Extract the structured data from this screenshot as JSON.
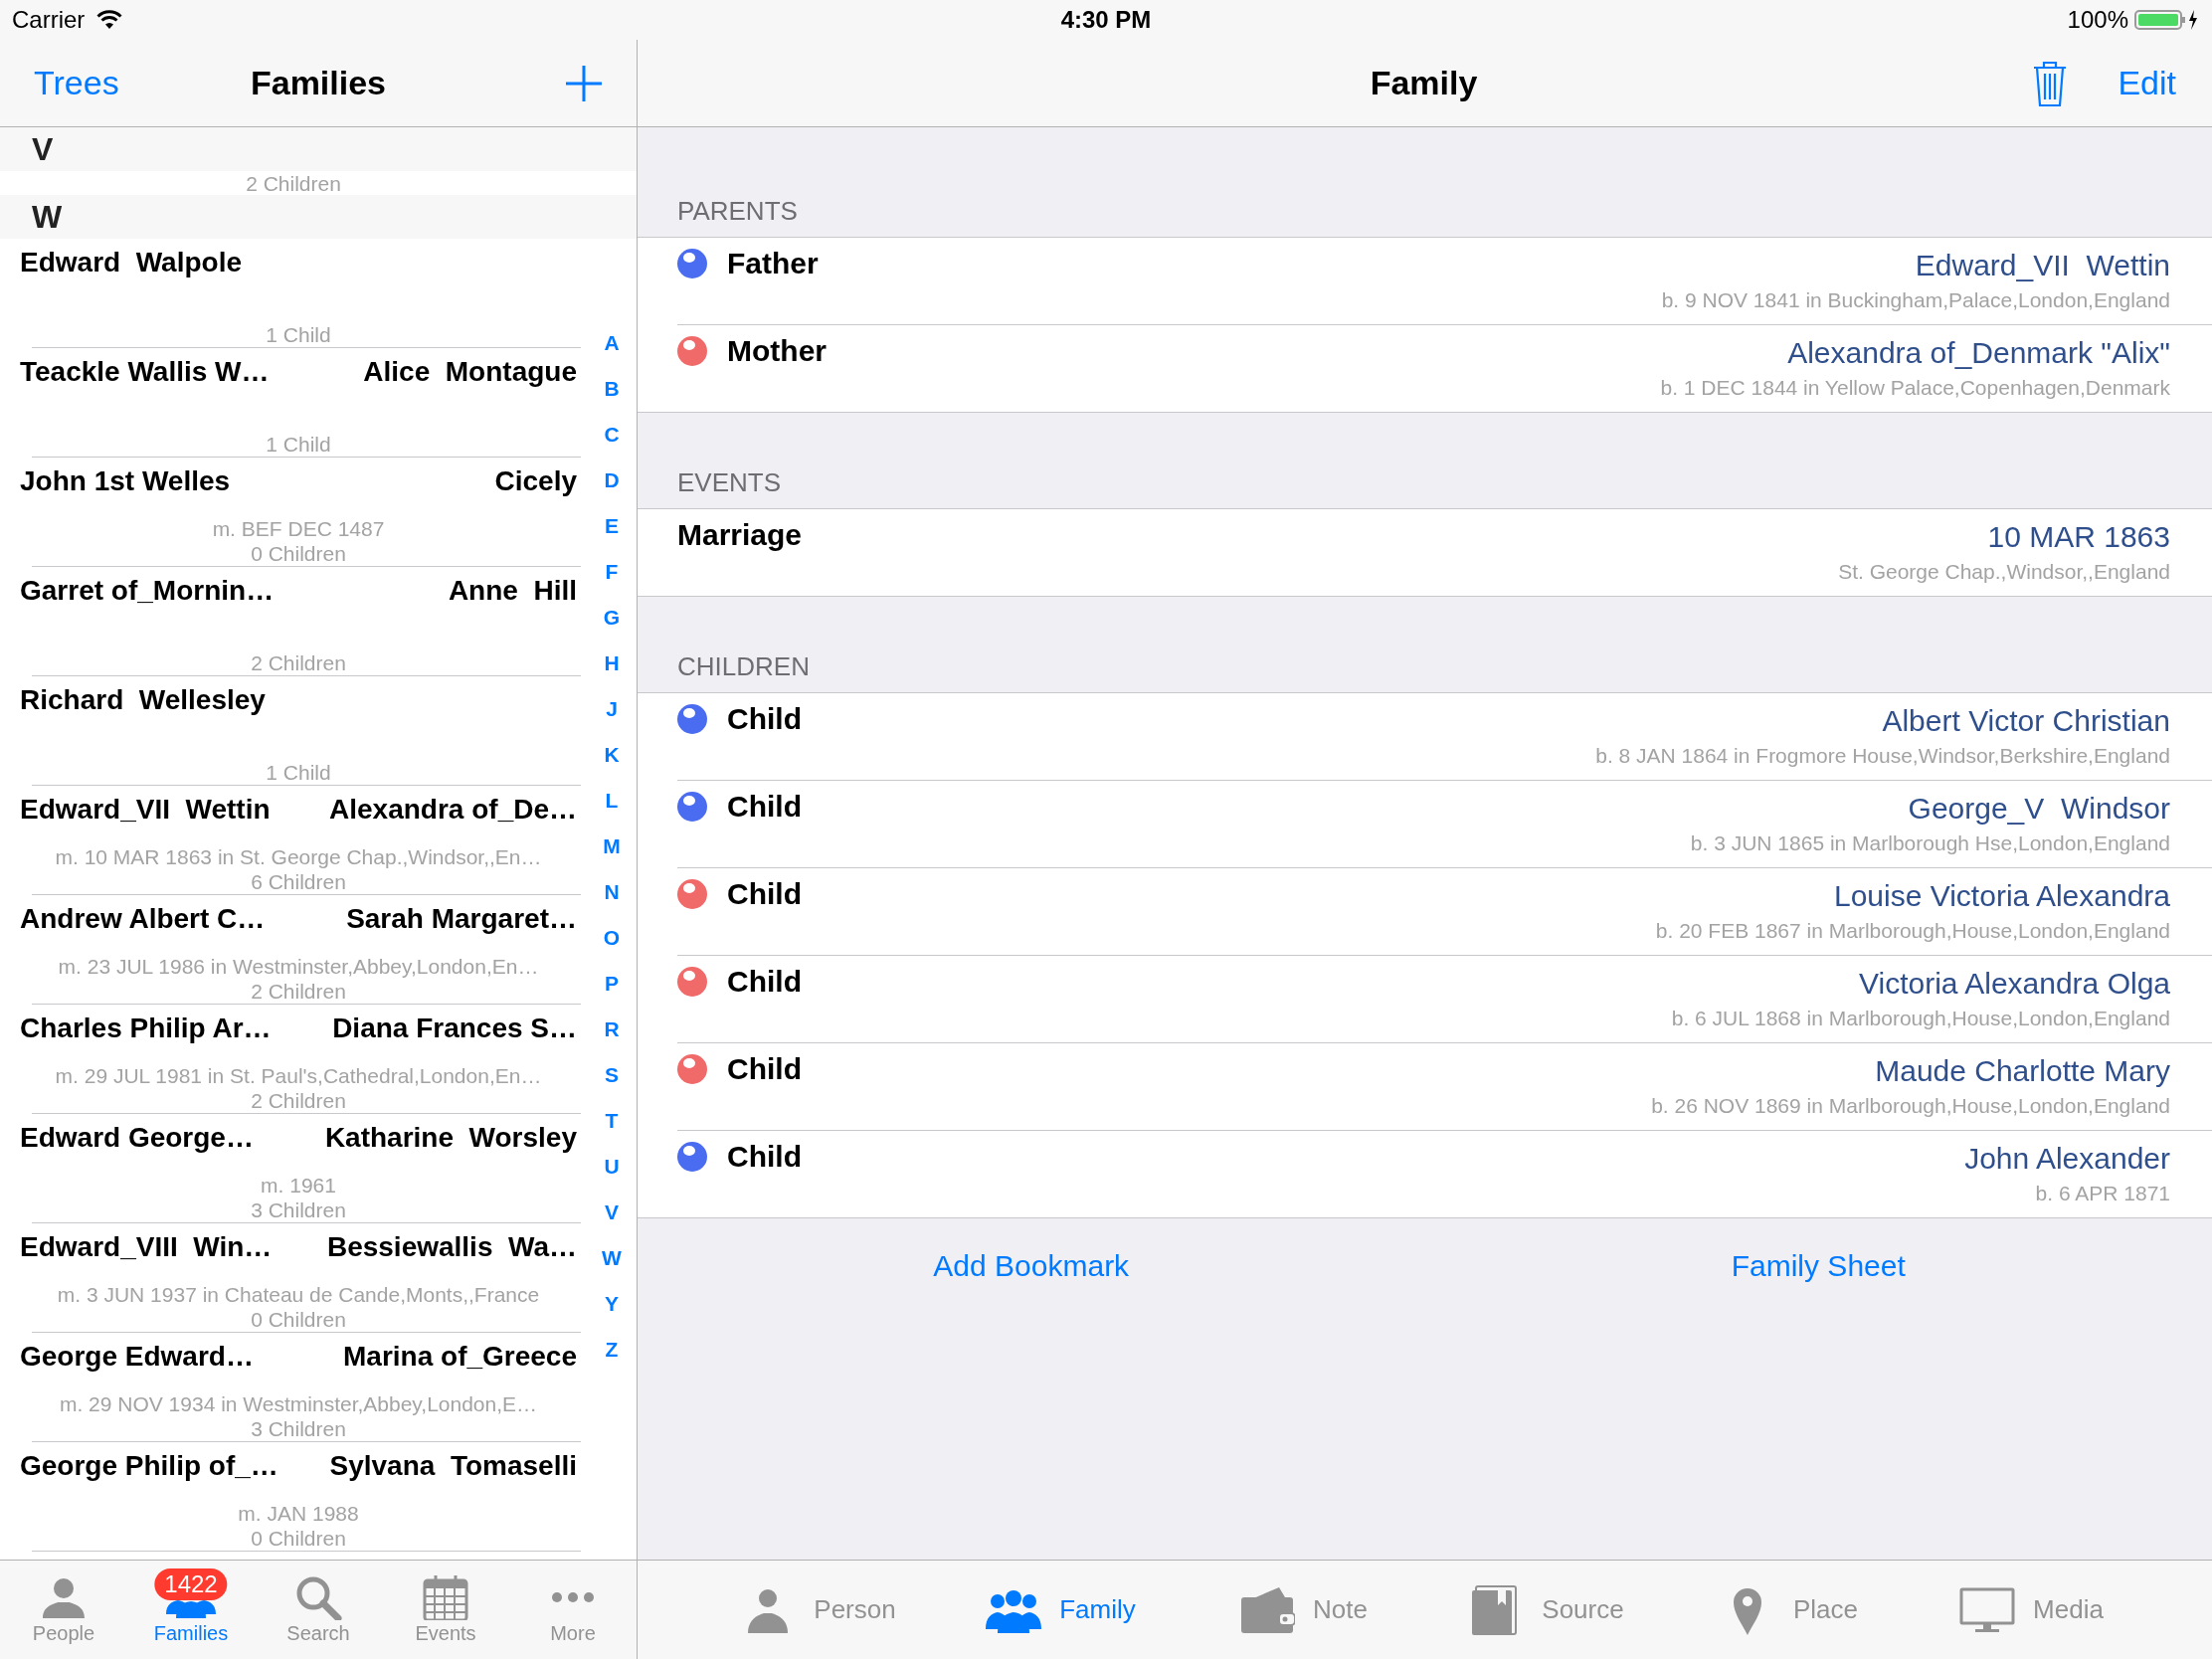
{
  "status_bar": {
    "carrier": "Carrier",
    "time": "4:30 PM",
    "battery": "100%"
  },
  "families_nav": {
    "back_button": "Trees",
    "title": "Families"
  },
  "families_list": {
    "sections": [
      {
        "letter": "V",
        "rows": [
          {
            "kind": "peek",
            "children": "2 Children"
          }
        ]
      },
      {
        "letter": "W",
        "rows": [
          {
            "kind": "family",
            "husband": "Edward  Walpole",
            "children": "1 Child"
          },
          {
            "kind": "family",
            "husband": "Teackle Wallis W…",
            "wife": "Alice  Montague",
            "children": "1 Child"
          },
          {
            "kind": "family",
            "husband": "John 1st Welles",
            "wife": "Cicely",
            "marriage": "m. BEF DEC 1487",
            "children": "0 Children"
          },
          {
            "kind": "family",
            "husband": "Garret of_Mornin…",
            "wife": "Anne  Hill",
            "children": "2 Children"
          },
          {
            "kind": "family",
            "husband": "Richard  Wellesley",
            "children": "1 Child"
          },
          {
            "kind": "family",
            "husband": "Edward_VII  Wettin",
            "wife": "Alexandra of_De…",
            "marriage": "m. 10 MAR 1863 in St. George Chap.,Windsor,,En…",
            "children": "6 Children"
          },
          {
            "kind": "family",
            "husband": "Andrew Albert C…",
            "wife": "Sarah Margaret…",
            "marriage": "m. 23 JUL 1986 in Westminster,Abbey,London,En…",
            "children": "2 Children"
          },
          {
            "kind": "family",
            "husband": "Charles Philip Ar…",
            "wife": "Diana Frances S…",
            "marriage": "m. 29 JUL 1981 in St. Paul's,Cathedral,London,En…",
            "children": "2 Children"
          },
          {
            "kind": "family",
            "husband": "Edward George…",
            "wife": "Katharine  Worsley",
            "marriage": "m. 1961",
            "children": "3 Children"
          },
          {
            "kind": "family",
            "husband": "Edward_VIII  Win…",
            "wife": "Bessiewallis  Wa…",
            "marriage": "m. 3 JUN 1937 in Chateau de Cande,Monts,,France",
            "children": "0 Children"
          },
          {
            "kind": "family",
            "husband": "George Edward…",
            "wife": "Marina of_Greece",
            "marriage": "m. 29 NOV 1934 in Westminster,Abbey,London,E…",
            "children": "3 Children"
          },
          {
            "kind": "family",
            "husband": "George Philip of_…",
            "wife": "Sylvana  Tomaselli",
            "marriage": "m. JAN 1988",
            "children": "0 Children"
          }
        ]
      }
    ]
  },
  "index_letters": [
    "A",
    "B",
    "C",
    "D",
    "E",
    "F",
    "G",
    "H",
    "J",
    "K",
    "L",
    "M",
    "N",
    "O",
    "P",
    "R",
    "S",
    "T",
    "U",
    "V",
    "W",
    "Y",
    "Z"
  ],
  "tab_bar": [
    {
      "label": "People",
      "selected": false
    },
    {
      "label": "Families",
      "selected": true,
      "badge": "1422"
    },
    {
      "label": "Search",
      "selected": false
    },
    {
      "label": "Events",
      "selected": false
    },
    {
      "label": "More",
      "selected": false
    }
  ],
  "family_nav": {
    "title": "Family",
    "edit_button": "Edit"
  },
  "family_sections": [
    {
      "header": "PARENTS",
      "rows": [
        {
          "kind": "person",
          "color": "#4a6cf0",
          "label": "Father",
          "value": "Edward_VII  Wettin",
          "detail": "b. 9 NOV 1841 in Buckingham,Palace,London,England"
        },
        {
          "kind": "person",
          "color": "#f06a6a",
          "label": "Mother",
          "value": "Alexandra of_Denmark \"Alix\"",
          "detail": "b. 1 DEC 1844 in Yellow Palace,Copenhagen,Denmark"
        }
      ]
    },
    {
      "header": "EVENTS",
      "rows": [
        {
          "kind": "event",
          "label": "Marriage",
          "value": "10 MAR 1863",
          "detail": "St. George Chap.,Windsor,,England"
        }
      ]
    },
    {
      "header": "CHILDREN",
      "rows": [
        {
          "kind": "person",
          "color": "#4a6cf0",
          "label": "Child",
          "value": "Albert Victor Christian",
          "detail": "b. 8 JAN 1864 in Frogmore House,Windsor,Berkshire,England"
        },
        {
          "kind": "person",
          "color": "#4a6cf0",
          "label": "Child",
          "value": "George_V  Windsor",
          "detail": "b. 3 JUN 1865 in Marlborough Hse,London,England"
        },
        {
          "kind": "person",
          "color": "#f06a6a",
          "label": "Child",
          "value": "Louise Victoria Alexandra",
          "detail": "b. 20 FEB 1867 in Marlborough,House,London,England"
        },
        {
          "kind": "person",
          "color": "#f06a6a",
          "label": "Child",
          "value": "Victoria Alexandra Olga",
          "detail": "b. 6 JUL 1868 in Marlborough,House,London,England"
        },
        {
          "kind": "person",
          "color": "#f06a6a",
          "label": "Child",
          "value": "Maude Charlotte Mary",
          "detail": "b. 26 NOV 1869 in Marlborough,House,London,England"
        },
        {
          "kind": "person",
          "color": "#4a6cf0",
          "label": "Child",
          "value": "John Alexander",
          "detail": "b. 6 APR 1871"
        }
      ]
    }
  ],
  "actions": [
    "Add Bookmark",
    "Family Sheet"
  ],
  "detail_tabs": [
    {
      "label": "Person",
      "selected": false
    },
    {
      "label": "Family",
      "selected": true
    },
    {
      "label": "Note",
      "selected": false
    },
    {
      "label": "Source",
      "selected": false
    },
    {
      "label": "Place",
      "selected": false
    },
    {
      "label": "Media",
      "selected": false
    }
  ]
}
